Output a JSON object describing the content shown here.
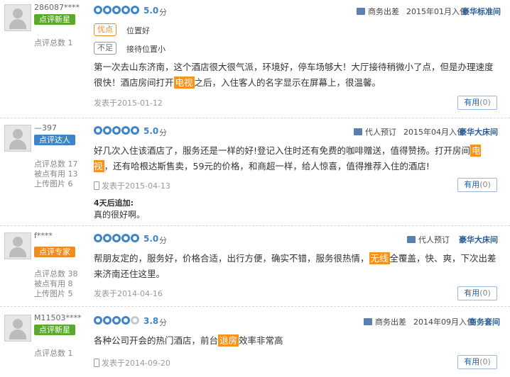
{
  "reviews": [
    {
      "username": "286087****",
      "badge": "点评新星",
      "stats": [
        "点评总数 1"
      ],
      "score": "5.0",
      "score_unit": "分",
      "rating": 5,
      "trip_type": "商务出差",
      "checkin": "2015年01月入住",
      "room": "豪华标准间",
      "pros_label": "优点",
      "pros_text": "位置好",
      "cons_label": "不足",
      "cons_text": "接待位置小",
      "text_before": "第一次去山东济南，这个酒店很大很气派，环境好，停车场够大！大厅接待稍微小了点，但是办理速度很快！酒店房间打开",
      "highlight": "电视",
      "text_after": "之后，入住客人的名字显示在屏幕上，很温馨。",
      "posted": "发表于2015-01-12",
      "useful_label": "有用",
      "useful_count": "(0)"
    },
    {
      "username": "—397",
      "badge": "点评达人",
      "stats": [
        "点评总数 17",
        "被点有用 13",
        "上传图片 6"
      ],
      "score": "5.0",
      "score_unit": "分",
      "rating": 5,
      "trip_type": "代人预订",
      "checkin": "2015年04月入住",
      "room": "豪华大床间",
      "text_before": "好几次入住该酒店了，服务还是一样的好!登记入住时还有免费的咖啡赠送，值得赞扬。打开房间",
      "highlight": "电视",
      "text_after": "，还有哈根达斯售卖，59元的价格，和商超一样，给人惊喜，值得推荐入住的酒店!",
      "posted": "发表于2015-04-13",
      "add_label": "4天后追加:",
      "add_text": "真的很好啊。",
      "useful_label": "有用",
      "useful_count": "(0)"
    },
    {
      "username": "f****",
      "badge": "点评专家",
      "stats": [
        "点评总数 38",
        "被点有用 8",
        "上传图片 5"
      ],
      "score": "5.0",
      "score_unit": "分",
      "rating": 5,
      "trip_type": "代人预订",
      "room": "豪华大床间",
      "text_before": "帮朋友定的，服务好，价格合适，出行方便，确实不错，服务很热情，",
      "highlight": "无线",
      "text_after": "全覆盖，快、爽，下次出差来济南还住这里。",
      "posted": "发表于2014-04-16",
      "useful_label": "有用",
      "useful_count": "(0)"
    },
    {
      "username": "M11503****",
      "badge": "点评新星",
      "stats": [
        "点评总数 1"
      ],
      "score": "3.8",
      "score_unit": "分",
      "rating": 3.8,
      "trip_type": "商务出差",
      "checkin": "2014年09月入住",
      "room": "商务套间",
      "text_before": "各种公司开会的热门酒店，前台",
      "highlight": "退房",
      "text_after": "效率非常高",
      "posted": "发表于2014-09-20",
      "useful_label": "有用",
      "useful_count": "(0)"
    }
  ]
}
